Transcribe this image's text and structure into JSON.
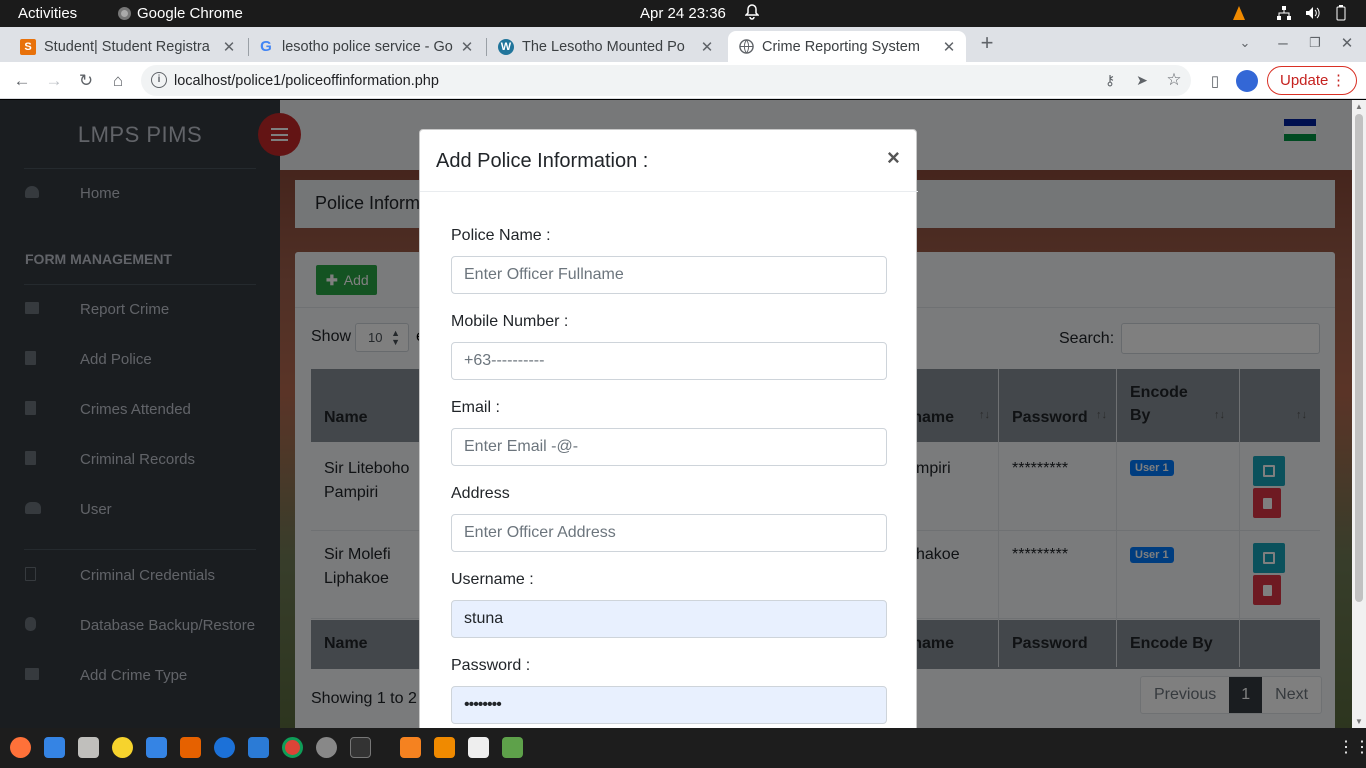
{
  "system": {
    "activities": "Activities",
    "app_name": "Google Chrome",
    "datetime": "Apr 24  23:36"
  },
  "browser": {
    "tabs": [
      {
        "title": "Student| Student Registra",
        "favicon": "student-portal-icon"
      },
      {
        "title": "lesotho police service - Go",
        "favicon": "google-icon"
      },
      {
        "title": "The Lesotho Mounted Po",
        "favicon": "wordpress-icon"
      },
      {
        "title": "Crime Reporting System",
        "favicon": "globe-icon",
        "active": true
      }
    ],
    "url": "localhost/police1/policeoffinformation.php",
    "update_label": "Update"
  },
  "sidebar": {
    "brand": "LMPS PIMS",
    "section_header": "FORM MANAGEMENT",
    "items": [
      {
        "label": "Home",
        "icon": "dashboard-icon"
      },
      {
        "label": "Report Crime",
        "icon": "folder-icon"
      },
      {
        "label": "Add Police",
        "icon": "file-icon"
      },
      {
        "label": "Crimes Attended",
        "icon": "file-icon"
      },
      {
        "label": "Criminal Records",
        "icon": "file-icon"
      },
      {
        "label": "User",
        "icon": "users-icon"
      },
      {
        "label": "Criminal Credentials",
        "icon": "file-outline-icon"
      },
      {
        "label": "Database Backup/Restore",
        "icon": "database-icon"
      },
      {
        "label": "Add Crime Type",
        "icon": "folder-icon"
      }
    ]
  },
  "main": {
    "page_title": "Police Inform",
    "add_label": "Add",
    "show_label": "Show",
    "entries_value": "10",
    "entries_suffix": "e",
    "search_label": "Search:",
    "columns": {
      "name": "Name",
      "username": "rname",
      "password": "Password",
      "encode_by": "Encode By",
      "encode_by_l1": "Encode",
      "encode_by_l2": "By"
    },
    "rows": [
      {
        "name_l1": "Sir Liteboho",
        "name_l2": "Pampiri",
        "username": "mpiri",
        "password": "*********",
        "encode_by": "User 1"
      },
      {
        "name_l1": "Sir Molefi",
        "name_l2": "Liphakoe",
        "username": "hakoe",
        "password": "*********",
        "encode_by": "User 1"
      }
    ],
    "footer_username": "rname",
    "showing_text": "Showing 1 to 2",
    "pager": {
      "previous": "Previous",
      "current": "1",
      "next": "Next"
    }
  },
  "modal": {
    "title": "Add Police Information :",
    "close": "×",
    "fields": {
      "police_name": {
        "label": "Police Name :",
        "placeholder": "Enter Officer Fullname",
        "value": ""
      },
      "mobile": {
        "label": "Mobile Number :",
        "placeholder": "+63----------",
        "value": ""
      },
      "email": {
        "label": "Email :",
        "placeholder": "Enter Email -@-",
        "value": ""
      },
      "address": {
        "label": "Address",
        "placeholder": "Enter Officer Address",
        "value": ""
      },
      "username": {
        "label": "Username :",
        "placeholder": "",
        "value": "stuna"
      },
      "password": {
        "label": "Password :",
        "placeholder": "",
        "value": "••••••••"
      }
    }
  },
  "colors": {
    "sidebar": "#343a40",
    "add_button": "#28a745",
    "edit_button": "#17a2b8",
    "delete_button": "#dc3545",
    "badge": "#007bff",
    "toggle": "#c62828"
  }
}
